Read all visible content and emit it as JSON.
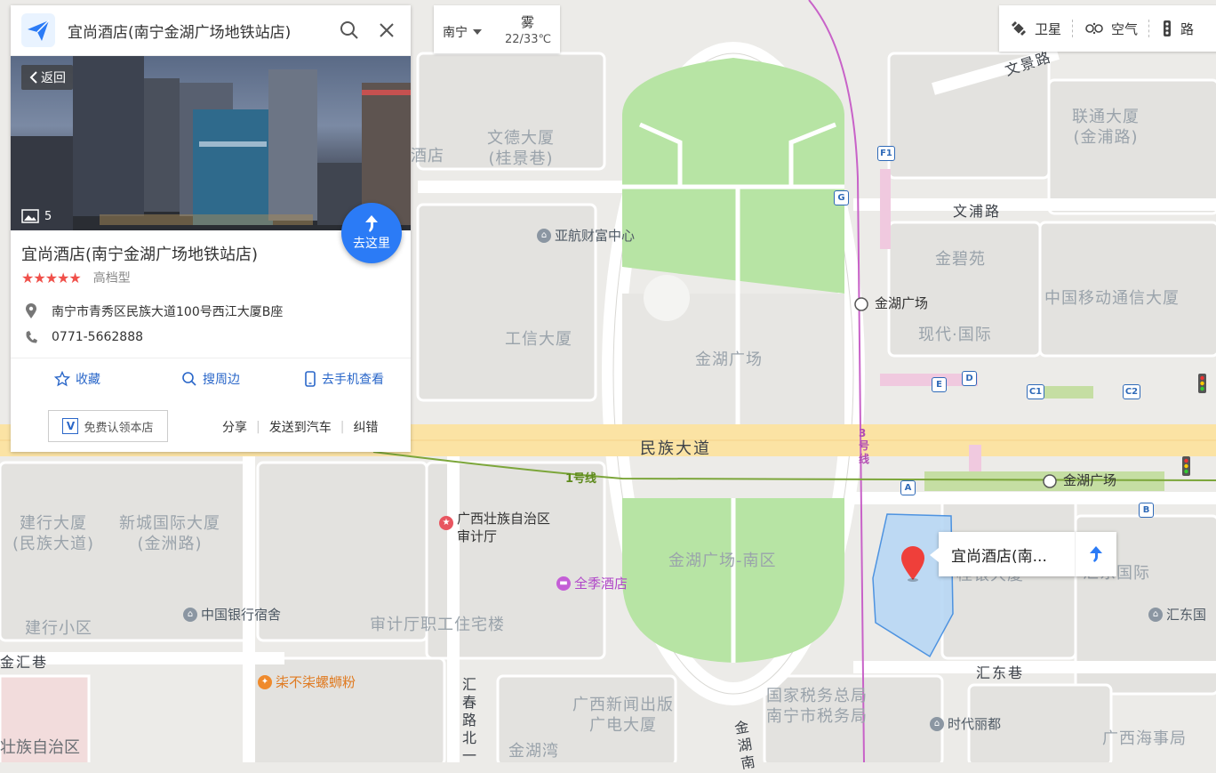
{
  "search": {
    "query": "宜尚酒店(南宁金湖广场地铁站店)"
  },
  "panel": {
    "back_label": "返回",
    "photo_count": "5",
    "go_here_label": "去这里",
    "name": "宜尚酒店(南宁金湖广场地铁站店)",
    "stars": 5,
    "stars_display": "★★★★★",
    "category": "高档型",
    "address": "南宁市青秀区民族大道100号西江大厦B座",
    "phone": "0771-5662888",
    "actions": {
      "favorite": "收藏",
      "nearby": "搜周边",
      "to_phone": "去手机查看"
    },
    "claim_label": "免费认领本店",
    "links": {
      "share": "分享",
      "send_to_car": "发送到汽车",
      "correct": "纠错"
    }
  },
  "weather": {
    "city": "南宁",
    "condition": "雾",
    "temp": "22/33℃"
  },
  "toolbar": {
    "satellite": "卫星",
    "air": "空气",
    "road": "路"
  },
  "callout": {
    "text": "宜尚酒店(南..."
  },
  "map": {
    "roads": {
      "minzu": "民族大道",
      "wenpu": "文浦路",
      "wenjing": "文景路",
      "huidong": "汇东巷",
      "jinhui": "金汇巷",
      "huichun": "汇春路北一",
      "jinhu": "金湖南",
      "line1": "1号线",
      "line3": "3号线"
    },
    "buildings": {
      "wende": "文德大厦\n(桂景巷)",
      "jiudian_left": "酒店",
      "liantong": "联通大厦\n(金浦路)",
      "jinbiyuan": "金碧苑",
      "chinamobile": "中国移动通信大厦",
      "xiandai": "现代·国际",
      "gongxin": "工信大厦",
      "jinhu_square": "金湖广场",
      "jinhu_south": "金湖广场-南区",
      "jianxing": "建行大厦\n(民族大道)",
      "xincheng": "新城国际大厦\n(金洲路)",
      "shenjiting": "审计厅职工住宅楼",
      "jianxing_xq": "建行小区",
      "xinwen": "广西新闻出版\n广电大厦",
      "guoshui": "国家税务总局\n南宁市税务局",
      "jinhuwan": "金湖湾",
      "guangxi_haishi": "广西海事局",
      "huidong_intl": "汇东国际",
      "guiyin": "桂银大厦",
      "zizhiqu": "壮族自治区"
    },
    "pois": {
      "yahang": "亚航财富中心",
      "shenji": "广西壮族自治区\n审计厅",
      "quanji": "全季酒店",
      "boc": "中国银行宿舍",
      "luosifen": "柒不柒螺蛳粉",
      "shidai": "时代丽都",
      "huidong_poi": "汇东国",
      "jinhu_station_n": "金湖广场",
      "jinhu_station_s": "金湖广场"
    },
    "exits": [
      "F1",
      "G",
      "E",
      "D",
      "C1",
      "C2",
      "A",
      "B"
    ]
  },
  "colors": {
    "accent": "#2b7bf6",
    "star": "#f0504a",
    "park": "#b7e4a4",
    "road_major": "#fbe3a4",
    "metro3": "#c862c8",
    "metro1": "#7ca63a",
    "hotel_area": "#b8d8f5"
  }
}
